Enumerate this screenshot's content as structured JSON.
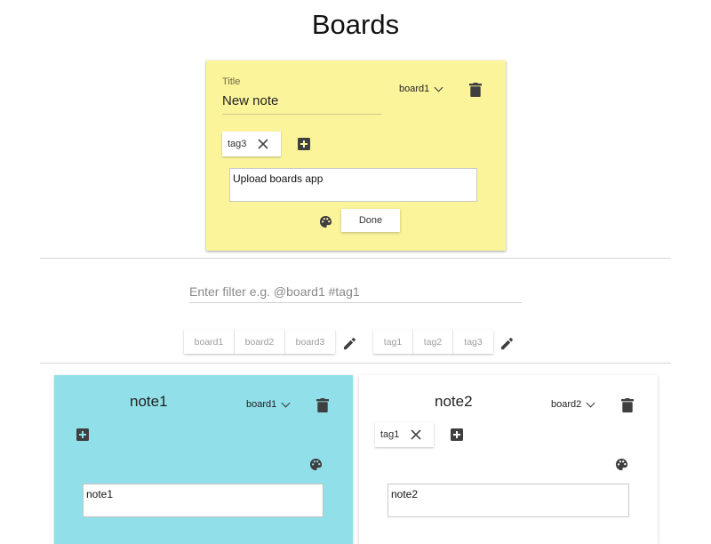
{
  "page": {
    "title": "Boards"
  },
  "editor": {
    "title_label": "Title",
    "title_value": "New note",
    "board": "board1",
    "tags": [
      "tag3"
    ],
    "content": "Upload boards app",
    "done_label": "Done",
    "color": "#fbf49b"
  },
  "filter": {
    "placeholder": "Enter filter e.g. @board1 #tag1",
    "value": ""
  },
  "boards": [
    "board1",
    "board2",
    "board3"
  ],
  "tags": [
    "tag1",
    "tag2",
    "tag3"
  ],
  "notes": [
    {
      "title": "note1",
      "board": "board1",
      "tags": [],
      "content": "note1",
      "color": "#90dfe9"
    },
    {
      "title": "note2",
      "board": "board2",
      "tags": [
        "tag1"
      ],
      "content": "note2",
      "color": "#ffffff"
    }
  ],
  "icons": [
    "chevron-down-icon",
    "delete-icon",
    "close-icon",
    "add-box-icon",
    "palette-icon",
    "edit-icon"
  ]
}
